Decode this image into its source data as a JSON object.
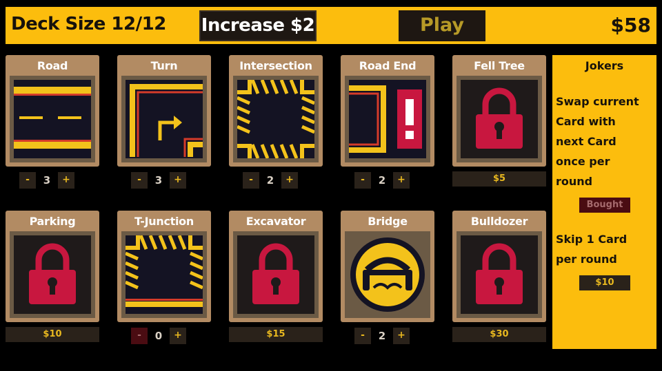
{
  "header": {
    "deck_size": "Deck Size 12/12",
    "increase_label": "Increase $2",
    "play_label": "Play",
    "money": "$58"
  },
  "cards": [
    {
      "title": "Road",
      "art": "road-straight",
      "count": "3"
    },
    {
      "title": "Turn",
      "art": "road-turn",
      "count": "3"
    },
    {
      "title": "Intersection",
      "art": "road-intersection",
      "count": "2"
    },
    {
      "title": "Road End",
      "art": "road-end",
      "count": "2"
    },
    {
      "title": "Fell Tree",
      "art": "lock-icon",
      "price": "$5"
    },
    {
      "title": "Parking",
      "art": "lock-icon",
      "price": "$10"
    },
    {
      "title": "T-Junction",
      "art": "road-t-junction",
      "count": "0"
    },
    {
      "title": "Excavator",
      "art": "lock-icon",
      "price": "$15"
    },
    {
      "title": "Bridge",
      "art": "bridge-icon",
      "count": "2"
    },
    {
      "title": "Bulldozer",
      "art": "lock-icon",
      "price": "$30"
    }
  ],
  "counter_labels": {
    "minus": "-",
    "plus": "+"
  },
  "jokers": {
    "title": "Jokers",
    "items": [
      {
        "description_lines": [
          "Swap current",
          "Card with",
          "next Card",
          "once per",
          "round"
        ],
        "button": "Bought",
        "state": "bought"
      },
      {
        "description_lines": [
          "Skip 1 Card",
          "per round"
        ],
        "button": "$10",
        "state": "available"
      }
    ]
  },
  "colors": {
    "accent_yellow": "#fcbd0d",
    "card_tan": "#b28b63",
    "dark": "#1e1712",
    "lock_red": "#c8173f",
    "road_stripe": "#f3c21b"
  }
}
